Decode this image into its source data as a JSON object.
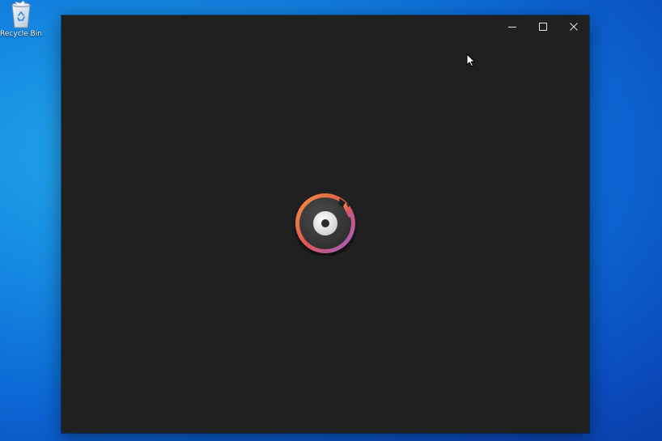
{
  "desktop": {
    "icons": [
      {
        "label": "Recycle Bin",
        "icon": "recycle-bin-icon"
      }
    ],
    "colors": {
      "background_light": "#22a6ea",
      "background_dark": "#0a3fa8"
    }
  },
  "window": {
    "background": "#202020",
    "caption_buttons": [
      {
        "name": "minimize",
        "icon": "minimize-icon"
      },
      {
        "name": "maximize",
        "icon": "maximize-icon"
      },
      {
        "name": "close",
        "icon": "close-icon"
      }
    ],
    "splash": {
      "icon": "groove-music-logo-icon",
      "colors": [
        "#f08a3e",
        "#e0594f",
        "#a45bd6"
      ]
    }
  },
  "cursor": {
    "icon": "mouse-pointer-icon"
  }
}
